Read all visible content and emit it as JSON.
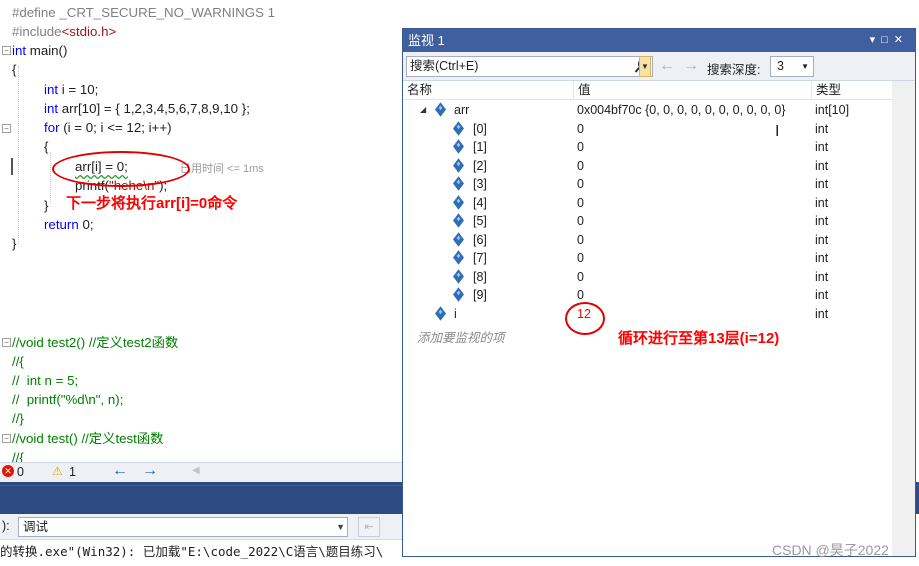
{
  "editor": {
    "lines": [
      {
        "id": "l1",
        "text": "#define _CRT_SECURE_NO_WARNINGS 1"
      },
      {
        "id": "l2a",
        "text": "#include"
      },
      {
        "id": "l2b",
        "text": "<stdio.h>"
      },
      {
        "id": "l3a",
        "text": "int"
      },
      {
        "id": "l3b",
        "text": " main()"
      },
      {
        "id": "l4",
        "text": "{"
      },
      {
        "id": "l5a",
        "text": "int"
      },
      {
        "id": "l5b",
        "text": " i = 10;"
      },
      {
        "id": "l6a",
        "text": "int"
      },
      {
        "id": "l6b",
        "text": " arr[10] = { 1,2,3,4,5,6,7,8,9,10 };"
      },
      {
        "id": "l7a",
        "text": "for"
      },
      {
        "id": "l7b",
        "text": " (i = 0; i <= 12; i++)"
      },
      {
        "id": "l8",
        "text": "{"
      },
      {
        "id": "l9",
        "text": "arr[i] = 0;"
      },
      {
        "id": "l10a",
        "text": "printf("
      },
      {
        "id": "l10b",
        "text": "\"hehe\\n\""
      },
      {
        "id": "l10c",
        "text": ");"
      },
      {
        "id": "l11",
        "text": "}"
      },
      {
        "id": "l12a",
        "text": "return"
      },
      {
        "id": "l12b",
        "text": " 0;"
      },
      {
        "id": "l13",
        "text": "}"
      },
      {
        "id": "l14",
        "text": "//void test2() //定义test2函数"
      },
      {
        "id": "l15",
        "text": "//{"
      },
      {
        "id": "l16",
        "text": "//  int n = 5;"
      },
      {
        "id": "l17",
        "text": "//  printf(\"%d\\n\", n);"
      },
      {
        "id": "l18",
        "text": "//}"
      },
      {
        "id": "l19",
        "text": "//void test() //定义test函数"
      },
      {
        "id": "l20",
        "text": "//{"
      }
    ],
    "exec_hint": "已用时间 <= 1ms",
    "annotation_next": "下一步将执行arr[i]=0命令"
  },
  "errbar": {
    "errors": "0",
    "warnings": "1"
  },
  "bottom": {
    "combo_prefix": "):",
    "combo_value": "调试",
    "output_text": "的转换.exe\"(Win32): 已加载\"E:\\code_2022\\C语言\\题目练习\\"
  },
  "watch": {
    "title": "监视 1",
    "search_placeholder": "搜索(Ctrl+E)",
    "depth_label": "搜索深度:",
    "depth_value": "3",
    "columns": {
      "name": "名称",
      "value": "值",
      "type": "类型"
    },
    "rows": [
      {
        "name": "arr",
        "value": "0x004bf70c {0, 0, 0, 0, 0, 0, 0, 0, 0, 0}",
        "type": "int[10]"
      },
      {
        "name": "[0]",
        "value": "0",
        "type": "int"
      },
      {
        "name": "[1]",
        "value": "0",
        "type": "int"
      },
      {
        "name": "[2]",
        "value": "0",
        "type": "int"
      },
      {
        "name": "[3]",
        "value": "0",
        "type": "int"
      },
      {
        "name": "[4]",
        "value": "0",
        "type": "int"
      },
      {
        "name": "[5]",
        "value": "0",
        "type": "int"
      },
      {
        "name": "[6]",
        "value": "0",
        "type": "int"
      },
      {
        "name": "[7]",
        "value": "0",
        "type": "int"
      },
      {
        "name": "[8]",
        "value": "0",
        "type": "int"
      },
      {
        "name": "[9]",
        "value": "0",
        "type": "int"
      },
      {
        "name": "i",
        "value": "12",
        "type": "int"
      }
    ],
    "add_watch": "添加要监视的项",
    "annotation_loop": "循环进行至第13层(i=12)"
  },
  "watermark": "CSDN @昊子2022",
  "colors": {
    "title_bar": "#3f5f9f",
    "annotation": "#ff0000",
    "keyword": "#0000ff",
    "comment": "#008000"
  }
}
